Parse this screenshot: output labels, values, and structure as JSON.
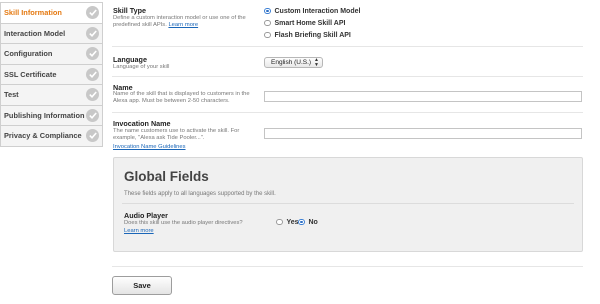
{
  "sidebar": {
    "items": [
      {
        "label": "Skill Information"
      },
      {
        "label": "Interaction Model"
      },
      {
        "label": "Configuration"
      },
      {
        "label": "SSL Certificate"
      },
      {
        "label": "Test"
      },
      {
        "label": "Publishing Information"
      },
      {
        "label": "Privacy & Compliance"
      }
    ],
    "active_index": 0
  },
  "skill_type": {
    "title": "Skill Type",
    "description": "Define a custom interaction model or use one of the predefined skill APIs.",
    "learn_more": "Learn more",
    "options": [
      {
        "label": "Custom Interaction Model"
      },
      {
        "label": "Smart Home Skill API"
      },
      {
        "label": "Flash Briefing Skill API"
      }
    ],
    "selected_index": 0
  },
  "language": {
    "title": "Language",
    "description": "Language of your skill",
    "selected": "English (U.S.)"
  },
  "name": {
    "title": "Name",
    "description": "Name of the skill that is displayed to customers in the Alexa app. Must be between 2-50 characters.",
    "value": ""
  },
  "invocation": {
    "title": "Invocation Name",
    "description": "The name customers use to activate the skill. For example, \"Alexa ask Tide Pooler...\".",
    "guidelines_link": "Invocation Name Guidelines",
    "value": ""
  },
  "global_fields": {
    "title": "Global Fields",
    "subtitle": "These fields apply to all languages supported by the skill.",
    "audio_player": {
      "title": "Audio Player",
      "description": "Does this skill use the audio player directives?",
      "learn_more": "Learn more",
      "options": [
        {
          "label": "Yes"
        },
        {
          "label": "No"
        }
      ],
      "selected_index": 1
    }
  },
  "save_label": "Save",
  "colors": {
    "active_sidebar": "#e47911",
    "link": "#1a66b8",
    "radio_selected": "#2f6fc4"
  },
  "icons": {
    "sidebar_status": "check-circle-icon",
    "select_arrows": "updown-arrows-icon"
  }
}
